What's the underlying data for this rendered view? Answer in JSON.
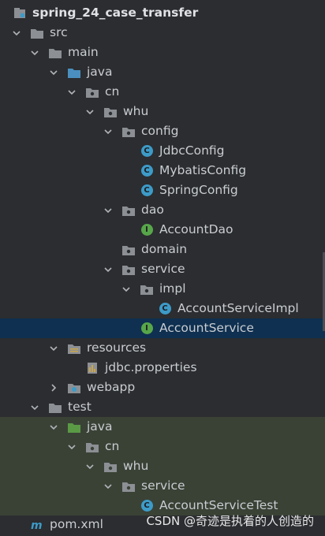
{
  "tree": {
    "project": "spring_24_case_transfer",
    "src": "src",
    "main": "main",
    "java": "java",
    "cn": "cn",
    "whu": "whu",
    "config": "config",
    "jdbc_config": "JdbcConfig",
    "mybatis_config": "MybatisConfig",
    "spring_config": "SpringConfig",
    "dao": "dao",
    "account_dao": "AccountDao",
    "domain": "domain",
    "service": "service",
    "impl": "impl",
    "account_service_impl": "AccountServiceImpl",
    "account_service": "AccountService",
    "resources": "resources",
    "jdbc_properties": "jdbc.properties",
    "webapp": "webapp",
    "test": "test",
    "test_java": "java",
    "test_cn": "cn",
    "test_whu": "whu",
    "test_service": "service",
    "account_service_test": "AccountServiceTest",
    "pom": "pom.xml"
  },
  "badges": {
    "class_letter": "C",
    "interface_letter": "I"
  },
  "watermark": "CSDN @奇迹是执着的人创造的",
  "colors": {
    "background": "#2b2d30",
    "selected_row": "#0f3050",
    "test_highlight": "#3a4236",
    "class_badge": "#3d9bc8",
    "interface_badge": "#57a64a",
    "source_folder": "#4a8fc0",
    "test_folder": "#5a9a45"
  }
}
